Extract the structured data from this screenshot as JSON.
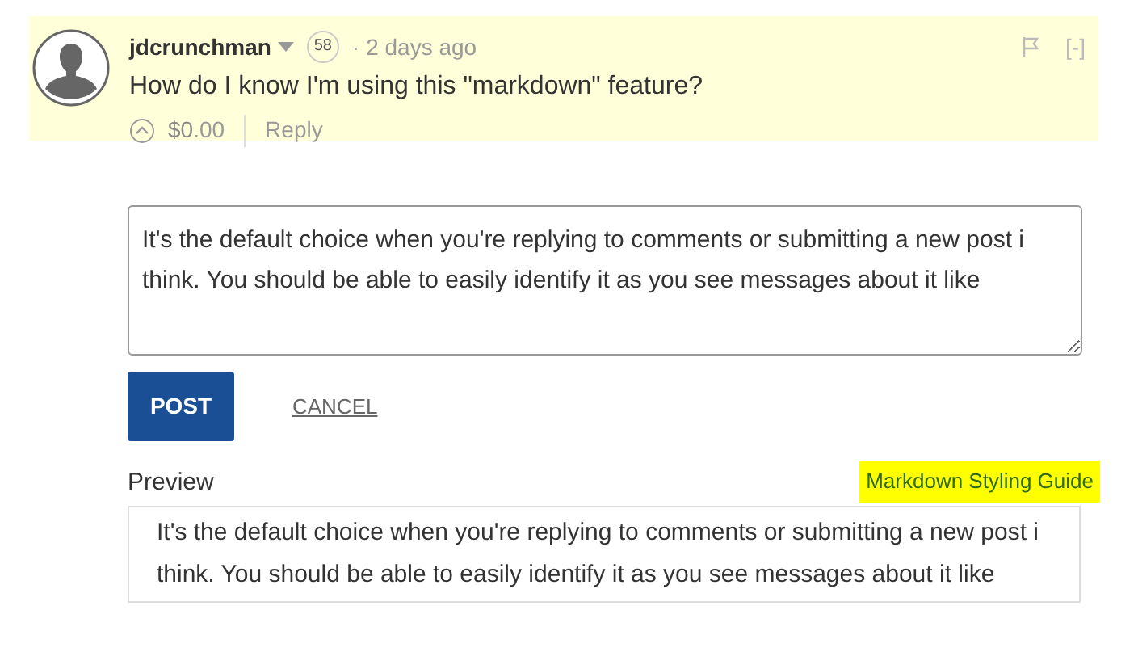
{
  "comment": {
    "author": "jdcrunchman",
    "score": "58",
    "separator": "·",
    "time": "2 days ago",
    "collapse": "[-]",
    "body": "How do I know I'm using this \"markdown\" feature?",
    "amount_whole": "$0",
    "amount_cents": ".00",
    "reply": "Reply",
    "highlighted": true
  },
  "editor": {
    "value": "It's the default choice when you're replying to comments or submitting a new post i think. You should be able to easily identify it as you see messages about it like"
  },
  "buttons": {
    "post": "POST",
    "cancel": "CANCEL"
  },
  "preview": {
    "label": "Preview",
    "guide_link": "Markdown Styling Guide",
    "guide_highlighted": true,
    "text": "It's the default choice when you're replying to comments or submitting a new post i think. You should be able to easily identify it as you see messages about it like"
  }
}
